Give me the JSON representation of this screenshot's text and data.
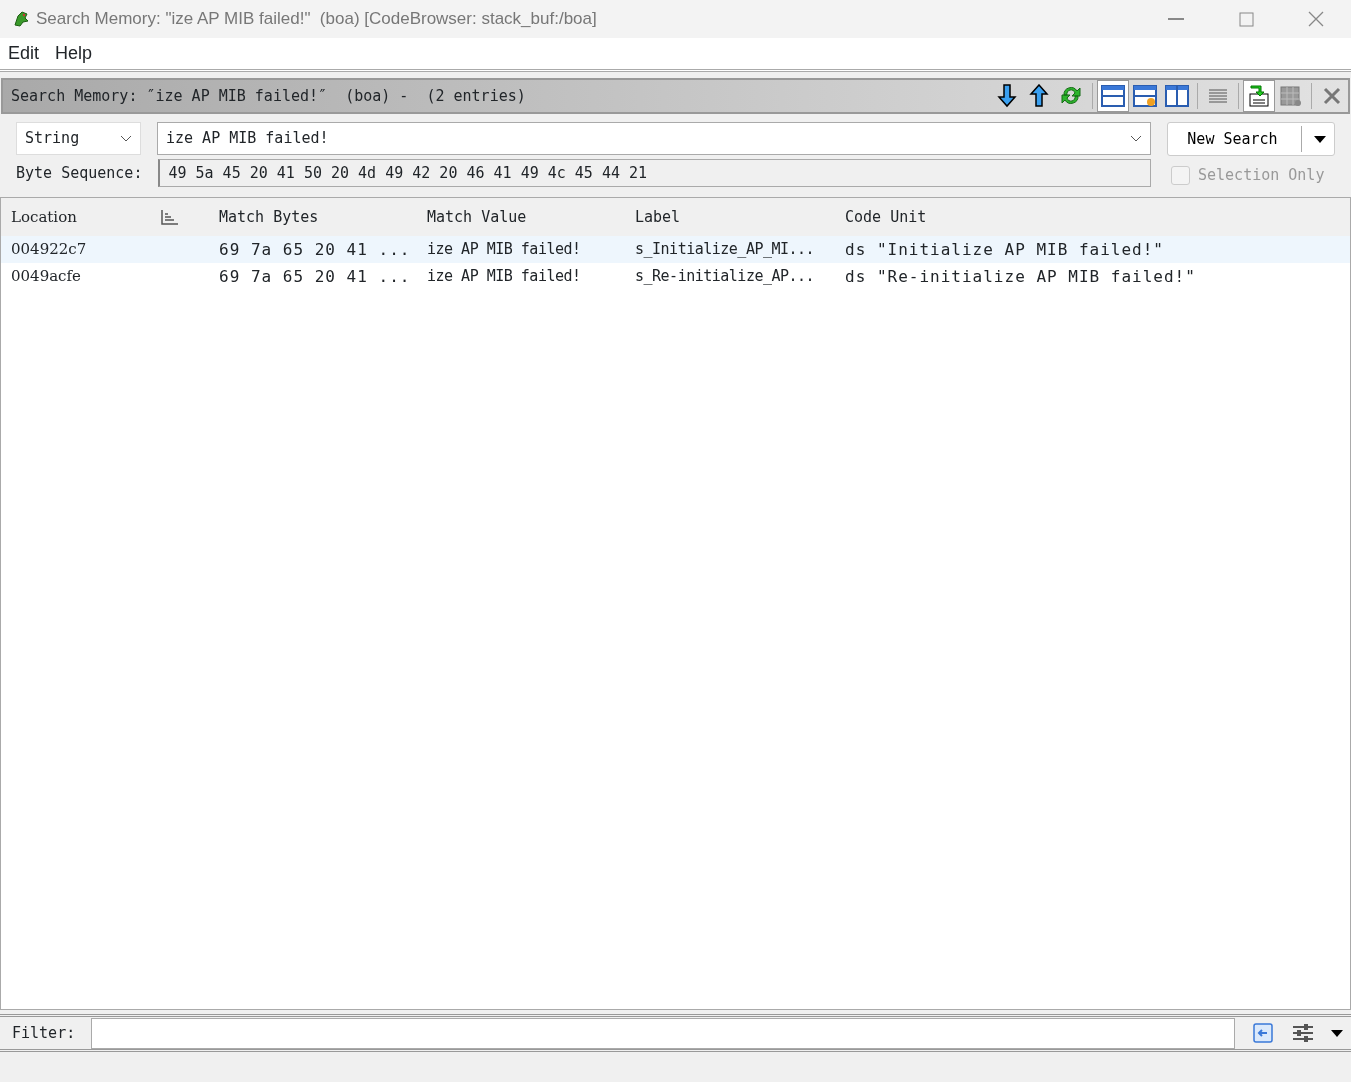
{
  "window": {
    "title": "Search Memory: \"ize AP MIB failed!\"  (boa) [CodeBrowser: stack_buf:/boa]"
  },
  "menu": [
    "Edit",
    "Help"
  ],
  "panel": {
    "title": "Search Memory: ″ize AP MIB failed!″  (boa) -  (2 entries)",
    "toolbar": [
      {
        "kind": "down",
        "selected": false
      },
      {
        "kind": "up",
        "selected": false
      },
      {
        "kind": "refresh",
        "selected": false
      },
      {
        "kind": "layout-rows",
        "selected": true
      },
      {
        "kind": "layout-detail",
        "selected": false
      },
      {
        "kind": "layout-columns",
        "selected": false
      },
      {
        "kind": "lines",
        "selected": false
      },
      {
        "kind": "export",
        "selected": true
      },
      {
        "kind": "table",
        "selected": false
      },
      {
        "kind": "close",
        "selected": false
      }
    ]
  },
  "search": {
    "format": "String",
    "value": "ize AP MIB failed!",
    "byte_sequence_label": "Byte Sequence:",
    "byte_sequence": "49 5a 45 20 41 50 20 4d 49 42 20 46 41 49 4c 45 44 21",
    "new_search": "New Search",
    "selection_only": {
      "label": "Selection Only",
      "checked": false,
      "disabled": true
    }
  },
  "table": {
    "columns": [
      "Location",
      "",
      "Match Bytes",
      "Match Value",
      "Label",
      "Code Unit"
    ],
    "rows": [
      {
        "selected": true,
        "cells": [
          "004922c7",
          "",
          "69 7a 65 20 41 ...",
          "ize AP MIB failed!",
          "s_Initialize_AP_MI...",
          "ds \"Initialize AP MIB failed!\""
        ]
      },
      {
        "selected": false,
        "cells": [
          "0049acfe",
          "",
          "69 7a 65 20 41 ...",
          "ize AP MIB failed!",
          "s_Re-initialize_AP...",
          "ds \"Re-initialize AP MIB failed!\""
        ]
      }
    ]
  },
  "filter": {
    "label": "Filter:"
  }
}
